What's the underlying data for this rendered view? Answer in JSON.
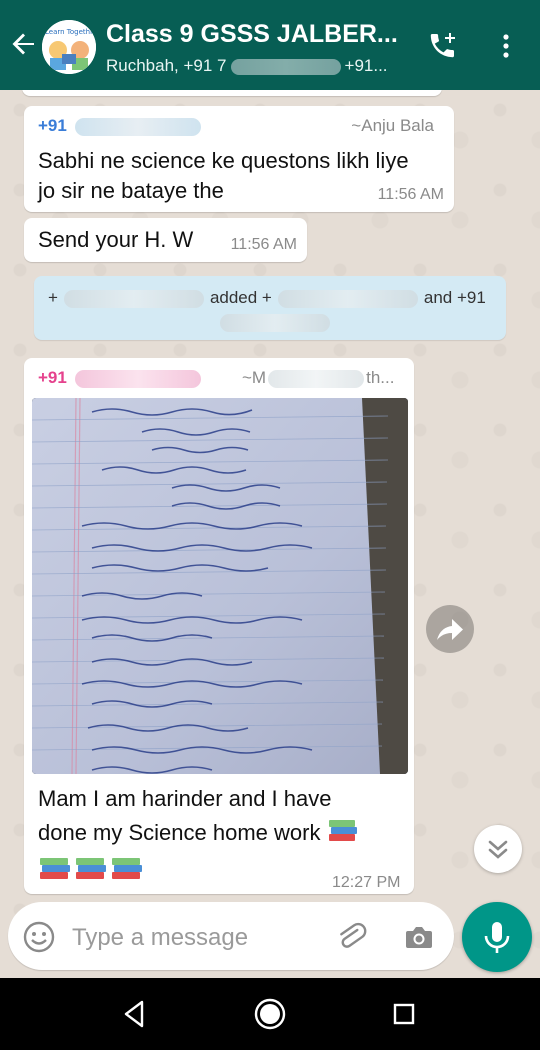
{
  "header": {
    "title": "Class 9 GSSS JALBER...",
    "subtitle_prefix": "Ruchbah, +91 7",
    "subtitle_suffix": "+91..."
  },
  "messages": {
    "m1": {
      "sender_prefix": "+91",
      "alias": "~Anju Bala",
      "text_line1": "Sabhi ne science ke questons likh liye",
      "text_line2": "jo sir ne bataye the",
      "time": "11:56 AM"
    },
    "m2": {
      "text": "Send your H. W",
      "time": "11:56 AM"
    },
    "system": {
      "prefix": "+",
      "mid": "added +",
      "suffix": "and +91"
    },
    "m3": {
      "sender_prefix": "+91",
      "alias_prefix": "~M",
      "alias_suffix": "th...",
      "text_line1": "Mam I am harinder and I have",
      "text_line2": "done my Science home work",
      "time": "12:27 PM"
    }
  },
  "composer": {
    "placeholder": "Type a message"
  },
  "colors": {
    "header": "#075e54",
    "accent": "#009688",
    "sender1": "#3a7dd8",
    "sender3": "#e5428d",
    "system_bg": "#d4eaf4"
  },
  "icons": {
    "back": "arrow-left-icon",
    "call": "add-call-icon",
    "menu": "more-vert-icon",
    "forward": "forward-icon",
    "scroll": "double-chevron-down-icon",
    "emoji": "emoji-icon",
    "attach": "paperclip-icon",
    "camera": "camera-icon",
    "mic": "mic-icon",
    "books": "books-icon"
  }
}
